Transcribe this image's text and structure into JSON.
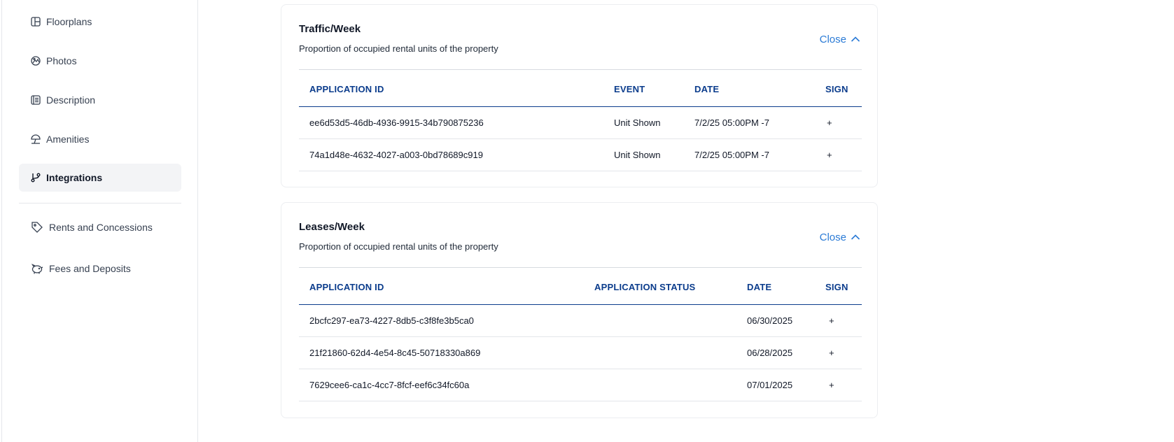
{
  "sidebar": {
    "items": [
      {
        "label": "Floorplans",
        "icon": "floorplan-icon"
      },
      {
        "label": "Photos",
        "icon": "photo-icon"
      },
      {
        "label": "Description",
        "icon": "description-icon"
      },
      {
        "label": "Amenities",
        "icon": "amenities-icon"
      },
      {
        "label": "Integrations",
        "icon": "integrations-icon",
        "active": true
      },
      {
        "label": "Rents and Concessions",
        "icon": "tag-icon"
      },
      {
        "label": "Fees and Deposits",
        "icon": "piggy-bank-icon"
      }
    ]
  },
  "traffic": {
    "title": "Traffic/Week",
    "subtitle": "Proportion of occupied rental units of the property",
    "close_label": "Close",
    "columns": [
      "APPLICATION ID",
      "EVENT",
      "DATE",
      "SIGN"
    ],
    "rows": [
      {
        "id": "ee6d53d5-46db-4936-9915-34b790875236",
        "event": "Unit Shown",
        "date": "7/2/25 05:00PM -7",
        "sign": "+"
      },
      {
        "id": "74a1d48e-4632-4027-a003-0bd78689c919",
        "event": "Unit Shown",
        "date": "7/2/25 05:00PM -7",
        "sign": "+"
      }
    ]
  },
  "leases": {
    "title": "Leases/Week",
    "subtitle": "Proportion of occupied rental units of the property",
    "close_label": "Close",
    "columns": [
      "APPLICATION ID",
      "APPLICATION STATUS",
      "DATE",
      "SIGN"
    ],
    "rows": [
      {
        "id": "2bcfc297-ea73-4227-8db5-c3f8fe3b5ca0",
        "status": "",
        "date": "06/30/2025",
        "sign": "+"
      },
      {
        "id": "21f21860-62d4-4e54-8c45-50718330a869",
        "status": "",
        "date": "06/28/2025",
        "sign": "+"
      },
      {
        "id": "7629cee6-ca1c-4cc7-8fcf-eef6c34fc60a",
        "status": "",
        "date": "07/01/2025",
        "sign": "+"
      }
    ]
  },
  "colors": {
    "accent": "#2b7bd6",
    "header_text": "#0b3c8c",
    "active_bg": "#f3f4f6"
  }
}
